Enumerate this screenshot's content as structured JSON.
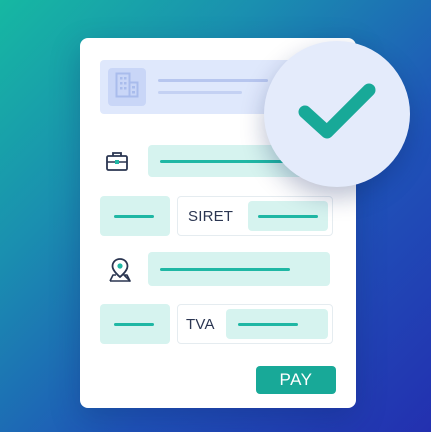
{
  "form": {
    "siret_label": "SIRET",
    "tva_label": "TVA",
    "pay_button_label": "PAY"
  },
  "icons": {
    "company_logo": "building-icon",
    "business": "briefcase-icon",
    "location": "map-pin-icon",
    "success": "checkmark-icon"
  },
  "colors": {
    "accent": "#18a998",
    "field_fill": "#d6f3ef",
    "field_line": "#1fb7a4",
    "header_fill": "#dfe8fc",
    "check_circle": "#e4ebfb"
  }
}
